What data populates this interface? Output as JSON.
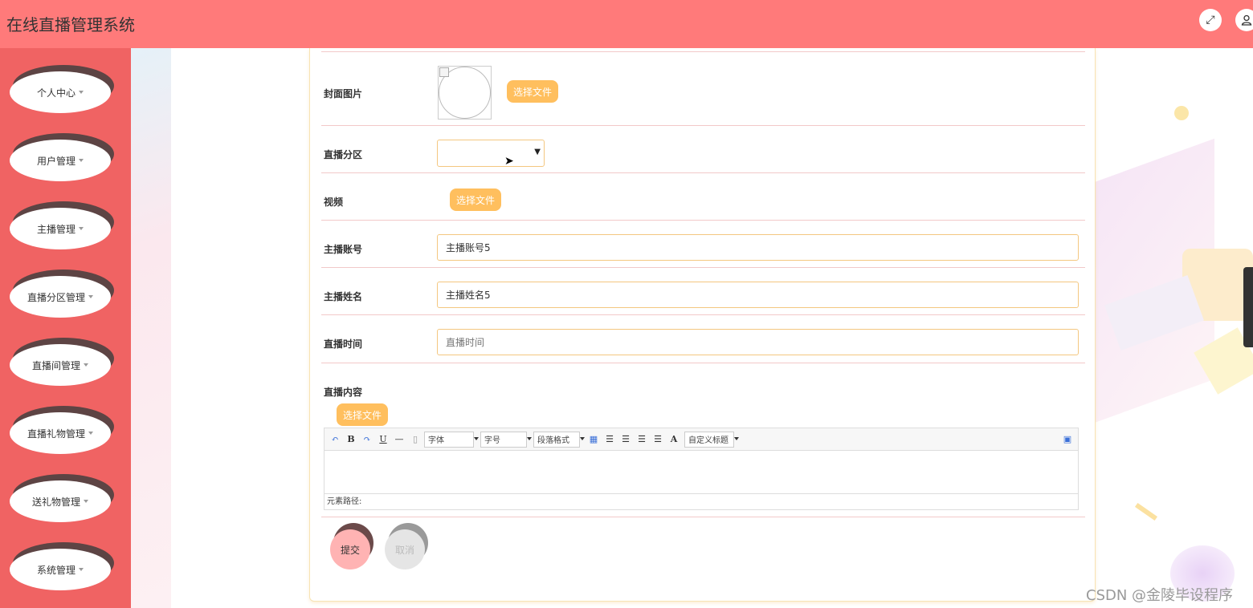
{
  "app": {
    "title": "在线直播管理系统"
  },
  "header": {
    "fullscreen_icon": "expand-icon",
    "user_icon": "user-icon"
  },
  "sidebar": {
    "items": [
      {
        "label": "个人中心"
      },
      {
        "label": "用户管理"
      },
      {
        "label": "主播管理"
      },
      {
        "label": "直播分区管理"
      },
      {
        "label": "直播间管理"
      },
      {
        "label": "直播礼物管理"
      },
      {
        "label": "送礼物管理"
      },
      {
        "label": "系统管理"
      }
    ]
  },
  "form": {
    "cover": {
      "label": "封面图片",
      "button": "选择文件"
    },
    "category": {
      "label": "直播分区",
      "value": ""
    },
    "video": {
      "label": "视频",
      "button": "选择文件"
    },
    "anchor_account": {
      "label": "主播账号",
      "value": "主播账号5"
    },
    "anchor_name": {
      "label": "主播姓名",
      "value": "主播姓名5"
    },
    "live_time": {
      "label": "直播时间",
      "placeholder": "直播时间"
    },
    "content": {
      "label": "直播内容",
      "button": "选择文件",
      "toolbar": {
        "font": "字体",
        "size": "字号",
        "paragraph": "段落格式",
        "custom_title": "自定义标题"
      },
      "path_label": "元素路径:"
    },
    "submit": "提交",
    "cancel": "取消"
  },
  "watermark": "CSDN @金陵毕设程序",
  "colors": {
    "header": "#ff7a7a",
    "sidebar": "#f06363",
    "accent": "#ffbf5e",
    "submit": "#ffb3b3",
    "cancel": "#e5e5e5"
  }
}
